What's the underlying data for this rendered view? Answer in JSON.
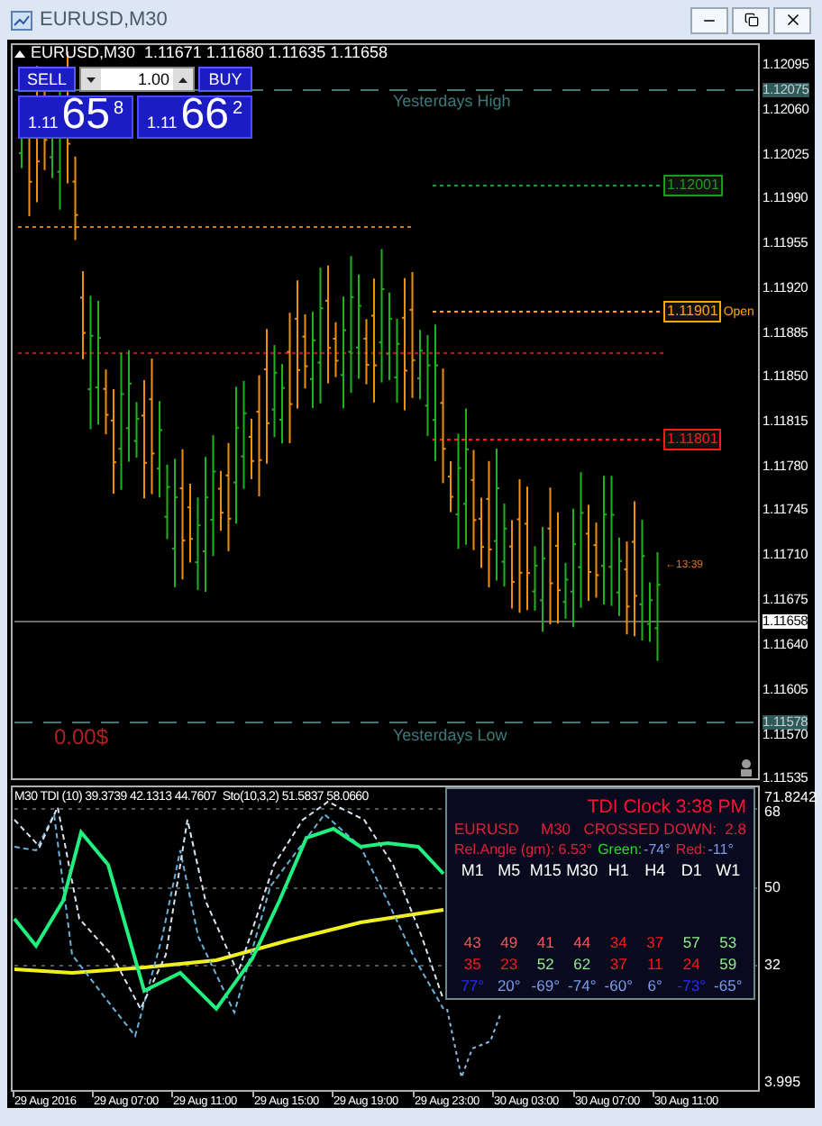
{
  "window": {
    "title": "EURUSD,M30"
  },
  "chart": {
    "header": "EURUSD,M30  1.11671 1.11680 1.11635 1.11658",
    "trade_panel": {
      "sell_button": "SELL",
      "buy_button": "BUY",
      "lot": "1.00",
      "sell_quote": {
        "prefix": "1.11",
        "pips": "65",
        "fraction": "8"
      },
      "buy_quote": {
        "prefix": "1.11",
        "pips": "66",
        "fraction": "2"
      }
    },
    "level_labels": [
      "Yesterdays High",
      "Yesterdays Low"
    ],
    "price_tags": [
      {
        "text": "1.12001",
        "color": "#1f9a1f"
      },
      {
        "text": "1.11901",
        "color": "#ffa500",
        "note": "Open"
      },
      {
        "text": "1.11801",
        "color": "#ff1a1a"
      }
    ],
    "time_marker": "←13:39",
    "balance": "0.00$",
    "price_axis": [
      {
        "text": "1.12095",
        "kind": "tick"
      },
      {
        "text": "1.12075",
        "kind": "marker"
      },
      {
        "text": "1.12060",
        "kind": "tick"
      },
      {
        "text": "1.12025",
        "kind": "tick"
      },
      {
        "text": "1.11990",
        "kind": "tick"
      },
      {
        "text": "1.11955",
        "kind": "tick"
      },
      {
        "text": "1.11920",
        "kind": "tick"
      },
      {
        "text": "1.11885",
        "kind": "tick"
      },
      {
        "text": "1.11850",
        "kind": "tick"
      },
      {
        "text": "1.11815",
        "kind": "tick"
      },
      {
        "text": "1.11780",
        "kind": "tick"
      },
      {
        "text": "1.11745",
        "kind": "tick"
      },
      {
        "text": "1.11710",
        "kind": "tick"
      },
      {
        "text": "1.11675",
        "kind": "tick"
      },
      {
        "text": "1.11658",
        "kind": "current"
      },
      {
        "text": "1.11640",
        "kind": "tick"
      },
      {
        "text": "1.11605",
        "kind": "tick"
      },
      {
        "text": "1.11578",
        "kind": "marker"
      },
      {
        "text": "1.11570",
        "kind": "tick"
      },
      {
        "text": "1.11535",
        "kind": "tick"
      }
    ]
  },
  "indicator": {
    "header": "M30 TDI (10) 39.3739 42.1313 44.7607  Sto(10,3,2) 51.5837 58.0660",
    "axis": [
      "71.8242",
      "68",
      "50",
      "32",
      "3.995"
    ],
    "clock": {
      "title": "TDI Clock 3:38 PM",
      "symbol": "EURUSD",
      "timeframe": "M30",
      "signal": "CROSSED DOWN:  2.8",
      "angle": "Rel.Angle (gm): 6.53°",
      "green_label": "Green:",
      "green_value": "-74°",
      "red_label": "Red:",
      "red_value": "-11°",
      "timeframes": [
        "M1",
        "M5",
        "M15",
        "M30",
        "H1",
        "H4",
        "D1",
        "W1"
      ],
      "rows": [
        [
          {
            "text": "43",
            "color": "#f05a5a"
          },
          {
            "text": "49",
            "color": "#f05a5a"
          },
          {
            "text": "41",
            "color": "#f05a5a"
          },
          {
            "text": "44",
            "color": "#f05a5a"
          },
          {
            "text": "34",
            "color": "#ff1a1a"
          },
          {
            "text": "37",
            "color": "#ff1a1a"
          },
          {
            "text": "57",
            "color": "#90ee90"
          },
          {
            "text": "53",
            "color": "#90ee90"
          }
        ],
        [
          {
            "text": "35",
            "color": "#ff1a1a"
          },
          {
            "text": "23",
            "color": "#ff1a1a"
          },
          {
            "text": "52",
            "color": "#90ee90"
          },
          {
            "text": "62",
            "color": "#90ee90"
          },
          {
            "text": "37",
            "color": "#ff1a1a"
          },
          {
            "text": "11",
            "color": "#ff1a1a"
          },
          {
            "text": "24",
            "color": "#ff1a1a"
          },
          {
            "text": "59",
            "color": "#90ee90"
          }
        ],
        [
          {
            "text": "77°",
            "color": "#2a2aff"
          },
          {
            "text": "20°",
            "color": "#7b9cf0"
          },
          {
            "text": "-69°",
            "color": "#7b9cf0"
          },
          {
            "text": "-74°",
            "color": "#7b9cf0"
          },
          {
            "text": "-60°",
            "color": "#7b9cf0"
          },
          {
            "text": "6°",
            "color": "#7b9cf0"
          },
          {
            "text": "-73°",
            "color": "#2a2aff"
          },
          {
            "text": "-65°",
            "color": "#7b9cf0"
          }
        ]
      ]
    }
  },
  "time_axis": [
    "29 Aug 2016",
    "29 Aug 07:00",
    "29 Aug 11:00",
    "29 Aug 15:00",
    "29 Aug 19:00",
    "29 Aug 23:00",
    "30 Aug 03:00",
    "30 Aug 07:00",
    "30 Aug 11:00"
  ]
}
